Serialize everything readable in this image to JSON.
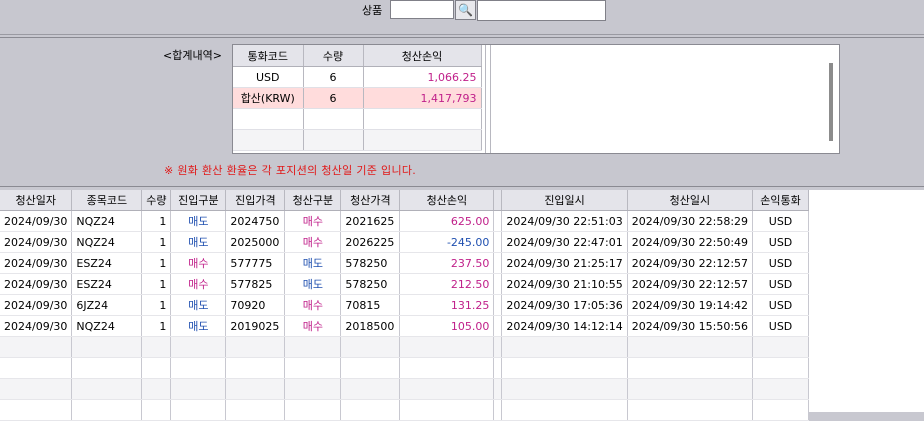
{
  "search": {
    "product_label": "상품",
    "product_code": "",
    "product_name": ""
  },
  "summary": {
    "label": "<합계내역>",
    "headers": [
      "통화코드",
      "수량",
      "청산손익"
    ],
    "rows": [
      {
        "currency": "USD",
        "qty": "6",
        "pnl": "1,066.25"
      },
      {
        "currency": "합산(KRW)",
        "qty": "6",
        "pnl": "1,417,793"
      }
    ],
    "notice": "※ 원화 환산 환율은 각 포지션의 청산일 기준 입니다."
  },
  "detail": {
    "headers": [
      "청산일자",
      "종목코드",
      "수량",
      "진입구분",
      "진입가격",
      "청산구분",
      "청산가격",
      "청산손익",
      "진입일시",
      "청산일시",
      "손익통화"
    ],
    "rows": [
      {
        "date": "2024/09/30",
        "code": "NQZ24",
        "qty": "1",
        "entry_side": "매도",
        "entry_price": "2024750",
        "exit_side": "매수",
        "exit_price": "2021625",
        "pnl": "625.00",
        "entry_time": "2024/09/30 22:51:03",
        "exit_time": "2024/09/30 22:58:29",
        "currency": "USD"
      },
      {
        "date": "2024/09/30",
        "code": "NQZ24",
        "qty": "1",
        "entry_side": "매도",
        "entry_price": "2025000",
        "exit_side": "매수",
        "exit_price": "2026225",
        "pnl": "-245.00",
        "entry_time": "2024/09/30 22:47:01",
        "exit_time": "2024/09/30 22:50:49",
        "currency": "USD"
      },
      {
        "date": "2024/09/30",
        "code": "ESZ24",
        "qty": "1",
        "entry_side": "매수",
        "entry_price": "577775",
        "exit_side": "매도",
        "exit_price": "578250",
        "pnl": "237.50",
        "entry_time": "2024/09/30 21:25:17",
        "exit_time": "2024/09/30 22:12:57",
        "currency": "USD"
      },
      {
        "date": "2024/09/30",
        "code": "ESZ24",
        "qty": "1",
        "entry_side": "매수",
        "entry_price": "577825",
        "exit_side": "매도",
        "exit_price": "578250",
        "pnl": "212.50",
        "entry_time": "2024/09/30 21:10:55",
        "exit_time": "2024/09/30 22:12:57",
        "currency": "USD"
      },
      {
        "date": "2024/09/30",
        "code": "6JZ24",
        "qty": "1",
        "entry_side": "매도",
        "entry_price": "70920",
        "exit_side": "매수",
        "exit_price": "70815",
        "pnl": "131.25",
        "entry_time": "2024/09/30 17:05:36",
        "exit_time": "2024/09/30 19:14:42",
        "currency": "USD"
      },
      {
        "date": "2024/09/30",
        "code": "NQZ24",
        "qty": "1",
        "entry_side": "매도",
        "entry_price": "2019025",
        "exit_side": "매수",
        "exit_price": "2018500",
        "pnl": "105.00",
        "entry_time": "2024/09/30 14:12:14",
        "exit_time": "2024/09/30 15:50:56",
        "currency": "USD"
      }
    ]
  },
  "colors": {
    "sell": "#2050b0",
    "buy": "#c0208a",
    "notice": "#e01818",
    "total_row_bg": "#ffdcdc"
  },
  "icons": {
    "search": "search-icon"
  }
}
